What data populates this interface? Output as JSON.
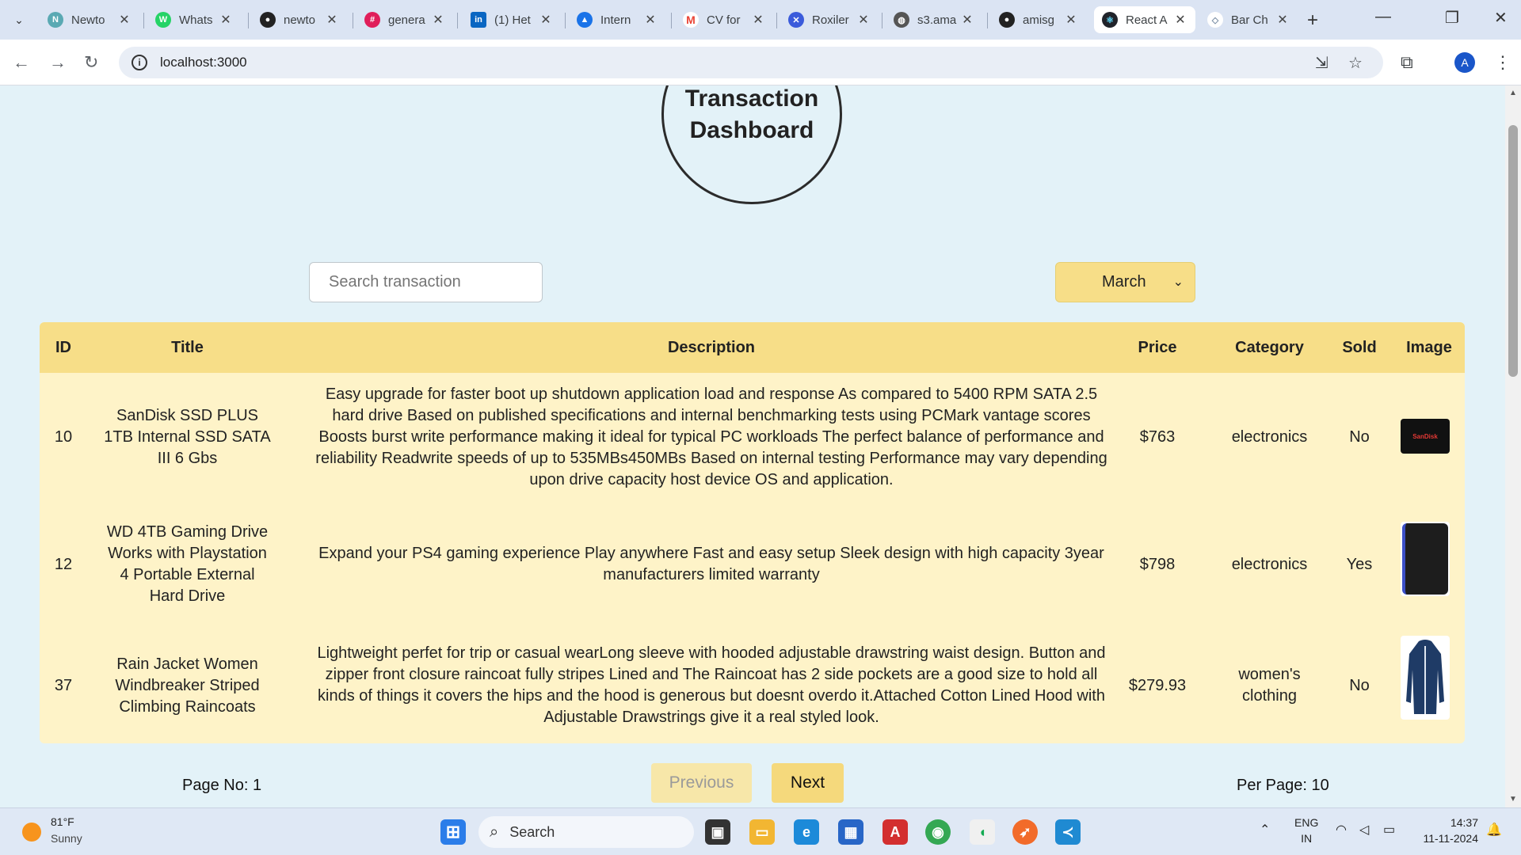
{
  "browser": {
    "tabs": [
      {
        "title": "Newto",
        "icon": "newton-icon",
        "color": "#5aa9b3"
      },
      {
        "title": "Whats",
        "icon": "whatsapp-icon",
        "color": "#25d366"
      },
      {
        "title": "newto",
        "icon": "github-icon",
        "color": "#222222"
      },
      {
        "title": "genera",
        "icon": "slack-icon",
        "color": "#e01e5a"
      },
      {
        "title": "(1) Het",
        "icon": "linkedin-icon",
        "color": "#0a66c2"
      },
      {
        "title": "Intern",
        "icon": "drive-icon",
        "color": "#1a73e8"
      },
      {
        "title": "CV for",
        "icon": "gmail-icon",
        "color": "#ea4335"
      },
      {
        "title": "Roxiler",
        "icon": "roxiler-icon",
        "color": "#3b5bdb"
      },
      {
        "title": "s3.ama",
        "icon": "globe-icon",
        "color": "#555555"
      },
      {
        "title": "amisg",
        "icon": "github-icon",
        "color": "#222222"
      },
      {
        "title": "React A",
        "icon": "react-icon",
        "color": "#20232a",
        "active": true
      },
      {
        "title": "Bar Ch",
        "icon": "chart-icon",
        "color": "#7b8fa6"
      }
    ],
    "url": "localhost:3000"
  },
  "page": {
    "title_line1": "Transaction",
    "title_line2": "Dashboard",
    "search_placeholder": "Search transaction",
    "month_selected": "March",
    "columns": [
      "ID",
      "Title",
      "Description",
      "Price",
      "Category",
      "Sold",
      "Image"
    ],
    "rows": [
      {
        "id": "10",
        "title": "SanDisk SSD PLUS 1TB Internal SSD SATA III 6 Gbs",
        "description": "Easy upgrade for faster boot up shutdown application load and response As compared to 5400 RPM SATA 2.5 hard drive Based on published specifications and internal benchmarking tests using PCMark vantage scores Boosts burst write performance making it ideal for typical PC workloads The perfect balance of performance and reliability Readwrite speeds of up to 535MBs450MBs Based on internal testing Performance may vary depending upon drive capacity host device OS and application.",
        "price": "$763",
        "category": "electronics",
        "sold": "No",
        "image_label": "SanDisk"
      },
      {
        "id": "12",
        "title": "WD 4TB Gaming Drive Works with Playstation 4 Portable External Hard Drive",
        "description": "Expand your PS4 gaming experience Play anywhere Fast and easy setup Sleek design with high capacity 3year manufacturers limited warranty",
        "price": "$798",
        "category": "electronics",
        "sold": "Yes",
        "image_label": ""
      },
      {
        "id": "37",
        "title": "Rain Jacket Women Windbreaker Striped Climbing Raincoats",
        "description": "Lightweight perfet for trip or casual wearLong sleeve with hooded adjustable drawstring waist design. Button and zipper front closure raincoat fully stripes Lined and The Raincoat has 2 side pockets are a good size to hold all kinds of things it covers the hips and the hood is generous but doesnt overdo it.Attached Cotton Lined Hood with Adjustable Drawstrings give it a real styled look.",
        "price": "$279.93",
        "category": "women's clothing",
        "sold": "No",
        "image_label": ""
      }
    ],
    "pagination": {
      "page_label": "Page No: 1",
      "prev_label": "Previous",
      "next_label": "Next",
      "per_page_label": "Per Page: 10"
    }
  },
  "taskbar": {
    "weather_temp": "81°F",
    "weather_desc": "Sunny",
    "search_label": "Search",
    "lang_line1": "ENG",
    "lang_line2": "IN",
    "time": "14:37",
    "date": "11-11-2024"
  },
  "colors": {
    "page_bg": "#e3f2f8",
    "header_bg": "#f7de88",
    "row_bg": "#fef3c8",
    "next_bg": "#f5d97c",
    "prev_bg": "#f7e7a9"
  }
}
